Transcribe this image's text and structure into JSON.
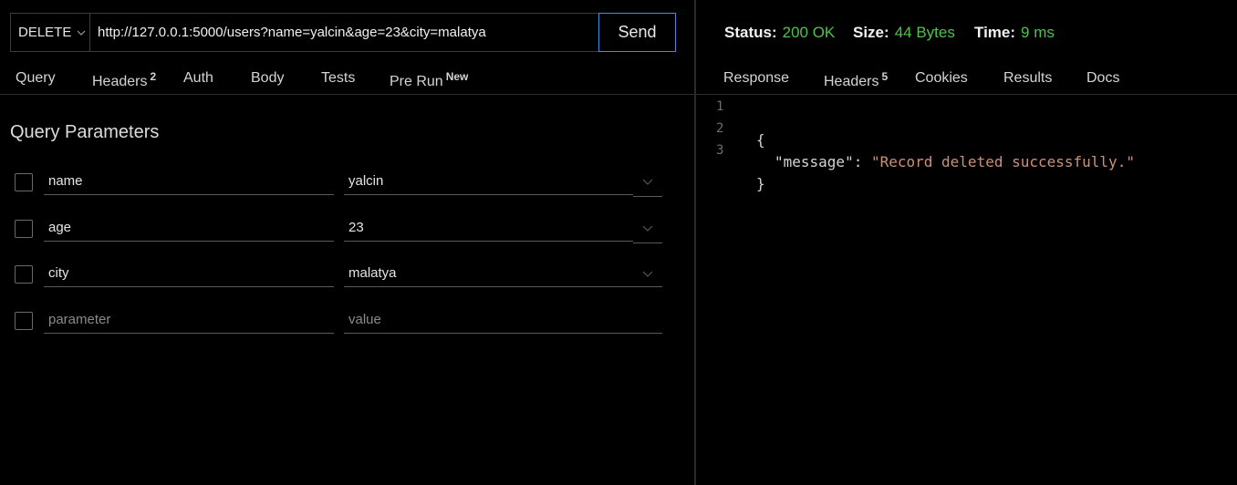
{
  "request": {
    "method": "DELETE",
    "url": "http://127.0.0.1:5000/users?name=yalcin&age=23&city=malatya",
    "send_label": "Send"
  },
  "request_tabs": [
    {
      "label": "Query",
      "badge": ""
    },
    {
      "label": "Headers",
      "badge": "2"
    },
    {
      "label": "Auth",
      "badge": ""
    },
    {
      "label": "Body",
      "badge": ""
    },
    {
      "label": "Tests",
      "badge": ""
    },
    {
      "label": "Pre Run",
      "badge": "New"
    }
  ],
  "query": {
    "title": "Query Parameters",
    "params": [
      {
        "key": "name",
        "value": "yalcin"
      },
      {
        "key": "age",
        "value": "23"
      },
      {
        "key": "city",
        "value": "malatya"
      }
    ],
    "new_param": {
      "key_placeholder": "parameter",
      "value_placeholder": "value"
    }
  },
  "response": {
    "status_label": "Status:",
    "status_value": "200 OK",
    "size_label": "Size:",
    "size_value": "44 Bytes",
    "time_label": "Time:",
    "time_value": "9 ms",
    "status_color": "#4ec24e",
    "tabs": [
      {
        "label": "Response",
        "badge": ""
      },
      {
        "label": "Headers",
        "badge": "5"
      },
      {
        "label": "Cookies",
        "badge": ""
      },
      {
        "label": "Results",
        "badge": ""
      },
      {
        "label": "Docs",
        "badge": ""
      }
    ],
    "body_lines": [
      {
        "num": "1",
        "open": "{"
      },
      {
        "num": "2",
        "key": "\"message\"",
        "sep": ": ",
        "value": "\"Record deleted successfully.\""
      },
      {
        "num": "3",
        "close": "}"
      }
    ]
  },
  "icons": {
    "method_dropdown": "chevron-down-icon",
    "param_dropdown": "chevron-down-icon"
  },
  "colors": {
    "accent": "#3a8ee6",
    "string": "#ce9178"
  }
}
